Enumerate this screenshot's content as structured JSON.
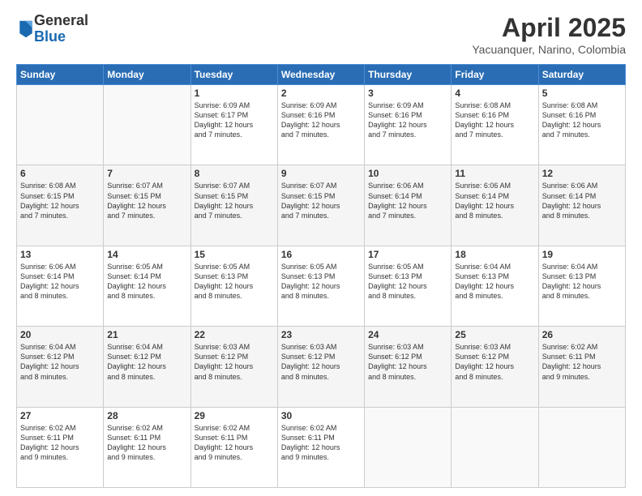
{
  "logo": {
    "general": "General",
    "blue": "Blue"
  },
  "title": "April 2025",
  "subtitle": "Yacuanquer, Narino, Colombia",
  "days_header": [
    "Sunday",
    "Monday",
    "Tuesday",
    "Wednesday",
    "Thursday",
    "Friday",
    "Saturday"
  ],
  "weeks": [
    {
      "shaded": false,
      "days": [
        {
          "num": "",
          "detail": ""
        },
        {
          "num": "",
          "detail": ""
        },
        {
          "num": "1",
          "detail": "Sunrise: 6:09 AM\nSunset: 6:17 PM\nDaylight: 12 hours\nand 7 minutes."
        },
        {
          "num": "2",
          "detail": "Sunrise: 6:09 AM\nSunset: 6:16 PM\nDaylight: 12 hours\nand 7 minutes."
        },
        {
          "num": "3",
          "detail": "Sunrise: 6:09 AM\nSunset: 6:16 PM\nDaylight: 12 hours\nand 7 minutes."
        },
        {
          "num": "4",
          "detail": "Sunrise: 6:08 AM\nSunset: 6:16 PM\nDaylight: 12 hours\nand 7 minutes."
        },
        {
          "num": "5",
          "detail": "Sunrise: 6:08 AM\nSunset: 6:16 PM\nDaylight: 12 hours\nand 7 minutes."
        }
      ]
    },
    {
      "shaded": true,
      "days": [
        {
          "num": "6",
          "detail": "Sunrise: 6:08 AM\nSunset: 6:15 PM\nDaylight: 12 hours\nand 7 minutes."
        },
        {
          "num": "7",
          "detail": "Sunrise: 6:07 AM\nSunset: 6:15 PM\nDaylight: 12 hours\nand 7 minutes."
        },
        {
          "num": "8",
          "detail": "Sunrise: 6:07 AM\nSunset: 6:15 PM\nDaylight: 12 hours\nand 7 minutes."
        },
        {
          "num": "9",
          "detail": "Sunrise: 6:07 AM\nSunset: 6:15 PM\nDaylight: 12 hours\nand 7 minutes."
        },
        {
          "num": "10",
          "detail": "Sunrise: 6:06 AM\nSunset: 6:14 PM\nDaylight: 12 hours\nand 7 minutes."
        },
        {
          "num": "11",
          "detail": "Sunrise: 6:06 AM\nSunset: 6:14 PM\nDaylight: 12 hours\nand 8 minutes."
        },
        {
          "num": "12",
          "detail": "Sunrise: 6:06 AM\nSunset: 6:14 PM\nDaylight: 12 hours\nand 8 minutes."
        }
      ]
    },
    {
      "shaded": false,
      "days": [
        {
          "num": "13",
          "detail": "Sunrise: 6:06 AM\nSunset: 6:14 PM\nDaylight: 12 hours\nand 8 minutes."
        },
        {
          "num": "14",
          "detail": "Sunrise: 6:05 AM\nSunset: 6:14 PM\nDaylight: 12 hours\nand 8 minutes."
        },
        {
          "num": "15",
          "detail": "Sunrise: 6:05 AM\nSunset: 6:13 PM\nDaylight: 12 hours\nand 8 minutes."
        },
        {
          "num": "16",
          "detail": "Sunrise: 6:05 AM\nSunset: 6:13 PM\nDaylight: 12 hours\nand 8 minutes."
        },
        {
          "num": "17",
          "detail": "Sunrise: 6:05 AM\nSunset: 6:13 PM\nDaylight: 12 hours\nand 8 minutes."
        },
        {
          "num": "18",
          "detail": "Sunrise: 6:04 AM\nSunset: 6:13 PM\nDaylight: 12 hours\nand 8 minutes."
        },
        {
          "num": "19",
          "detail": "Sunrise: 6:04 AM\nSunset: 6:13 PM\nDaylight: 12 hours\nand 8 minutes."
        }
      ]
    },
    {
      "shaded": true,
      "days": [
        {
          "num": "20",
          "detail": "Sunrise: 6:04 AM\nSunset: 6:12 PM\nDaylight: 12 hours\nand 8 minutes."
        },
        {
          "num": "21",
          "detail": "Sunrise: 6:04 AM\nSunset: 6:12 PM\nDaylight: 12 hours\nand 8 minutes."
        },
        {
          "num": "22",
          "detail": "Sunrise: 6:03 AM\nSunset: 6:12 PM\nDaylight: 12 hours\nand 8 minutes."
        },
        {
          "num": "23",
          "detail": "Sunrise: 6:03 AM\nSunset: 6:12 PM\nDaylight: 12 hours\nand 8 minutes."
        },
        {
          "num": "24",
          "detail": "Sunrise: 6:03 AM\nSunset: 6:12 PM\nDaylight: 12 hours\nand 8 minutes."
        },
        {
          "num": "25",
          "detail": "Sunrise: 6:03 AM\nSunset: 6:12 PM\nDaylight: 12 hours\nand 8 minutes."
        },
        {
          "num": "26",
          "detail": "Sunrise: 6:02 AM\nSunset: 6:11 PM\nDaylight: 12 hours\nand 9 minutes."
        }
      ]
    },
    {
      "shaded": false,
      "days": [
        {
          "num": "27",
          "detail": "Sunrise: 6:02 AM\nSunset: 6:11 PM\nDaylight: 12 hours\nand 9 minutes."
        },
        {
          "num": "28",
          "detail": "Sunrise: 6:02 AM\nSunset: 6:11 PM\nDaylight: 12 hours\nand 9 minutes."
        },
        {
          "num": "29",
          "detail": "Sunrise: 6:02 AM\nSunset: 6:11 PM\nDaylight: 12 hours\nand 9 minutes."
        },
        {
          "num": "30",
          "detail": "Sunrise: 6:02 AM\nSunset: 6:11 PM\nDaylight: 12 hours\nand 9 minutes."
        },
        {
          "num": "",
          "detail": ""
        },
        {
          "num": "",
          "detail": ""
        },
        {
          "num": "",
          "detail": ""
        }
      ]
    }
  ]
}
